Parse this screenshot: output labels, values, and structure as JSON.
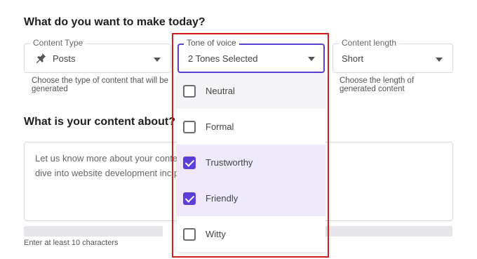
{
  "heading_make": "What do you want to make today?",
  "heading_about": "What is your content about?",
  "content_type": {
    "legend": "Content Type",
    "value": "Posts",
    "help": "Choose the type of content that will be generated"
  },
  "tone": {
    "legend": "Tone of voice",
    "value": "2 Tones Selected",
    "options": [
      {
        "label": "Neutral",
        "checked": false
      },
      {
        "label": "Formal",
        "checked": false
      },
      {
        "label": "Trustworthy",
        "checked": true
      },
      {
        "label": "Friendly",
        "checked": true
      },
      {
        "label": "Witty",
        "checked": false
      }
    ]
  },
  "content_length": {
    "legend": "Content length",
    "value": "Short",
    "help": "Choose the length of generated content"
  },
  "about": {
    "text": "Let us know more about your conte                                                    how to use WordPress to\ndive into website development inc                                                    ple way..."
  },
  "min_note": "Enter at least 10 characters",
  "colors": {
    "accent": "#5b3fd6",
    "highlight_border": "#d01e1e"
  }
}
